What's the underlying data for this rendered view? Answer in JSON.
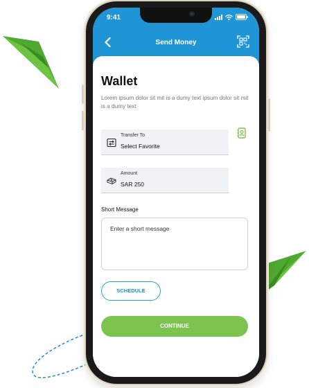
{
  "status_bar": {
    "time": "9:41"
  },
  "header": {
    "title": "Send Money",
    "back_icon": "chevron-left-icon",
    "qr_icon": "qr-scan-icon"
  },
  "page": {
    "title": "Wallet",
    "description": "Lorem ipsum dolor sit mit is a dumy text ipsum dolor sit mit is a dumy text"
  },
  "transfer_field": {
    "label": "Transfer To",
    "value": "Select Favorite",
    "icon": "transfer-icon"
  },
  "favorite_icon": "contact-book-icon",
  "amount_field": {
    "label": "Amount",
    "value": "SAR 250",
    "icon": "cash-icon"
  },
  "message": {
    "label": "Short Message",
    "placeholder": "Enter a short message"
  },
  "buttons": {
    "schedule": "SCHEDULE",
    "continue": "CONTINUE"
  },
  "colors": {
    "header_blue": "#1f95d6",
    "accent_green": "#7cc350",
    "outline_blue": "#27a3d8"
  }
}
